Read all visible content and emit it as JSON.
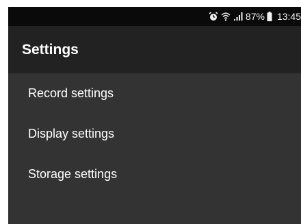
{
  "status_bar": {
    "icons": [
      "alarm-icon",
      "wifi-icon",
      "signal-icon",
      "battery-icon"
    ],
    "battery": "87%",
    "time": "13:45"
  },
  "app_bar": {
    "title": "Settings"
  },
  "settings_list": {
    "items": [
      {
        "label": "Record settings"
      },
      {
        "label": "Display settings"
      },
      {
        "label": "Storage settings"
      }
    ]
  },
  "colors": {
    "status_bar_bg": "#0a0a0a",
    "app_bar_bg": "#222222",
    "content_bg": "#333333",
    "text": "#ffffff"
  }
}
